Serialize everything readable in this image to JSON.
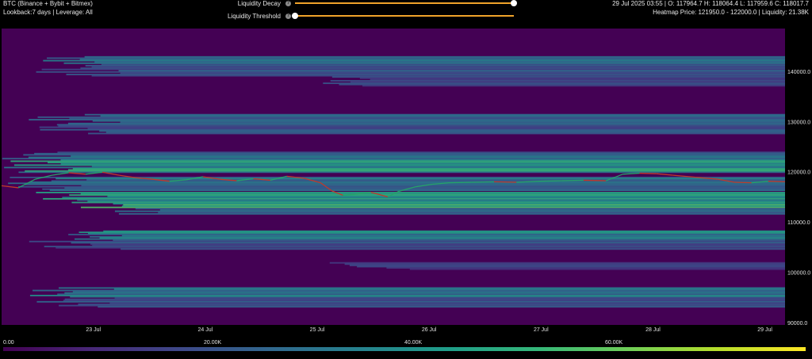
{
  "header": {
    "title": "BTC (Binance + Bybit + Bitmex)",
    "subtitle": "Lookback:7 days | Leverage: All",
    "ohlc": "29 Jul 2025 03:55 | O: 117964.7 H: 118064.4 L: 117959.6 C: 118017.7",
    "heatmap_info": "Heatmap Price: 121950.0 - 122000.0 | Liquidity: 21.38K"
  },
  "controls": {
    "decay_label": "Liquidity Decay",
    "threshold_label": "Liquidity Threshold",
    "info_icon": "info-icon",
    "decay_value": 1.0,
    "threshold_value": 0.0
  },
  "colors": {
    "background": "#440154",
    "price_up": "#26a269",
    "price_down": "#c0392b",
    "slider_track": "#f0a32a"
  },
  "chart_data": {
    "type": "heatmap",
    "x_tick_labels": [
      "23 Jul",
      "24 Jul",
      "25 Jul",
      "26 Jul",
      "27 Jul",
      "28 Jul",
      "29 Jul"
    ],
    "y_tick_labels": [
      "140000.0",
      "130000.0",
      "120000.0",
      "110000.0",
      "100000.0",
      "90000.0"
    ],
    "y_ticks": [
      140000,
      130000,
      120000,
      110000,
      100000,
      90000
    ],
    "ylim": [
      89500,
      148500
    ],
    "xlim": [
      0,
      7
    ],
    "x_tick_positions": [
      0.82,
      1.82,
      2.82,
      3.82,
      4.82,
      5.82,
      6.82
    ],
    "price_series": [
      {
        "t": 0.0,
        "p": 117200
      },
      {
        "t": 0.15,
        "p": 116800
      },
      {
        "t": 0.3,
        "p": 118500
      },
      {
        "t": 0.45,
        "p": 119300
      },
      {
        "t": 0.6,
        "p": 119800
      },
      {
        "t": 0.75,
        "p": 119500
      },
      {
        "t": 0.9,
        "p": 119900
      },
      {
        "t": 1.05,
        "p": 119300
      },
      {
        "t": 1.2,
        "p": 118800
      },
      {
        "t": 1.35,
        "p": 118500
      },
      {
        "t": 1.5,
        "p": 118100
      },
      {
        "t": 1.65,
        "p": 118400
      },
      {
        "t": 1.8,
        "p": 119000
      },
      {
        "t": 1.95,
        "p": 118500
      },
      {
        "t": 2.1,
        "p": 118200
      },
      {
        "t": 2.25,
        "p": 118600
      },
      {
        "t": 2.4,
        "p": 118300
      },
      {
        "t": 2.55,
        "p": 119100
      },
      {
        "t": 2.7,
        "p": 118700
      },
      {
        "t": 2.85,
        "p": 117800
      },
      {
        "t": 2.95,
        "p": 116200
      },
      {
        "t": 3.05,
        "p": 115300
      },
      {
        "t": 3.15,
        "p": 115500
      },
      {
        "t": 3.3,
        "p": 115900
      },
      {
        "t": 3.45,
        "p": 115000
      },
      {
        "t": 3.55,
        "p": 116100
      },
      {
        "t": 3.7,
        "p": 117000
      },
      {
        "t": 3.85,
        "p": 117500
      },
      {
        "t": 4.0,
        "p": 117800
      },
      {
        "t": 4.2,
        "p": 117900
      },
      {
        "t": 4.4,
        "p": 118000
      },
      {
        "t": 4.6,
        "p": 117900
      },
      {
        "t": 4.8,
        "p": 118100
      },
      {
        "t": 5.0,
        "p": 118200
      },
      {
        "t": 5.2,
        "p": 118300
      },
      {
        "t": 5.4,
        "p": 118200
      },
      {
        "t": 5.55,
        "p": 119500
      },
      {
        "t": 5.7,
        "p": 119700
      },
      {
        "t": 5.85,
        "p": 119600
      },
      {
        "t": 6.0,
        "p": 119300
      },
      {
        "t": 6.2,
        "p": 118900
      },
      {
        "t": 6.4,
        "p": 118500
      },
      {
        "t": 6.55,
        "p": 117900
      },
      {
        "t": 6.7,
        "p": 117800
      },
      {
        "t": 6.85,
        "p": 118100
      },
      {
        "t": 7.0,
        "p": 118000
      }
    ],
    "liquidity_bands": [
      {
        "low": 141000,
        "high": 143000,
        "level": 0.42,
        "start": 0.3
      },
      {
        "low": 139000,
        "high": 141000,
        "level": 0.32,
        "start": 0.2
      },
      {
        "low": 137000,
        "high": 139000,
        "level": 0.24,
        "start": 2.8
      },
      {
        "low": 129500,
        "high": 131500,
        "level": 0.42,
        "start": 0.2
      },
      {
        "low": 127500,
        "high": 129500,
        "level": 0.3,
        "start": 0.1
      },
      {
        "low": 122500,
        "high": 124000,
        "level": 0.4,
        "start": 0.0
      },
      {
        "low": 121200,
        "high": 122500,
        "level": 0.56,
        "start": 0.0
      },
      {
        "low": 119800,
        "high": 121200,
        "level": 0.62,
        "start": 0.0
      },
      {
        "low": 116200,
        "high": 119000,
        "level": 0.48,
        "start": 0.0
      },
      {
        "low": 114500,
        "high": 116000,
        "level": 0.58,
        "start": 0.3
      },
      {
        "low": 112800,
        "high": 114500,
        "level": 0.66,
        "start": 0.6
      },
      {
        "low": 111500,
        "high": 112800,
        "level": 0.35,
        "start": 0.6
      },
      {
        "low": 106500,
        "high": 108300,
        "level": 0.5,
        "start": 0.2
      },
      {
        "low": 104500,
        "high": 106500,
        "level": 0.3,
        "start": 0.2
      },
      {
        "low": 100500,
        "high": 102000,
        "level": 0.22,
        "start": 2.9
      },
      {
        "low": 95000,
        "high": 97000,
        "level": 0.5,
        "start": 0.2
      },
      {
        "low": 93000,
        "high": 95000,
        "level": 0.34,
        "start": 0.2
      }
    ]
  },
  "colorbar": {
    "labels": [
      "0.00",
      "20.00K",
      "40.00K",
      "60.00K"
    ],
    "positions": [
      0,
      0.25,
      0.5,
      0.75
    ]
  }
}
